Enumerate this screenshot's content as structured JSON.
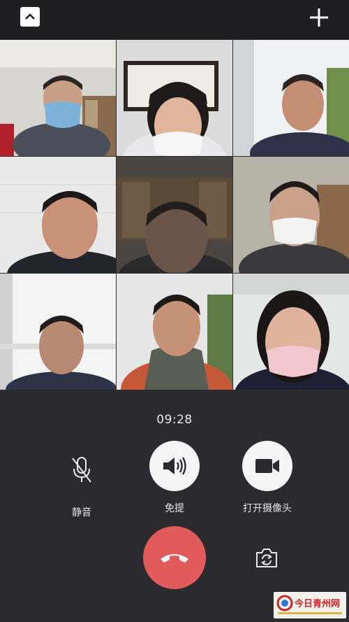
{
  "call": {
    "timer": "09:28",
    "participants": [
      {
        "id": "p1",
        "mask": "blue"
      },
      {
        "id": "p2",
        "mask": "white"
      },
      {
        "id": "p3",
        "mask": "none"
      },
      {
        "id": "p4",
        "mask": "none"
      },
      {
        "id": "p5",
        "mask": "none"
      },
      {
        "id": "p6",
        "mask": "white"
      },
      {
        "id": "p7",
        "mask": "none"
      },
      {
        "id": "p8",
        "mask": "none"
      },
      {
        "id": "p9",
        "mask": "pink"
      }
    ]
  },
  "controls": {
    "mute_label": "静音",
    "speaker_label": "免提",
    "camera_label": "打开摄像头"
  },
  "icons": {
    "collapse": "chevron-up-icon",
    "add": "plus-icon",
    "mute": "microphone-off-icon",
    "speaker": "speaker-icon",
    "camera": "video-camera-icon",
    "hangup": "phone-hangup-icon",
    "switch_camera": "camera-switch-icon"
  },
  "colors": {
    "background": "#2b2a2f",
    "hangup": "#e25b5b",
    "control_active": "#f4f4f4"
  },
  "watermark": {
    "text": "今日青州网",
    "subtext": "青州新闻门户网站"
  }
}
